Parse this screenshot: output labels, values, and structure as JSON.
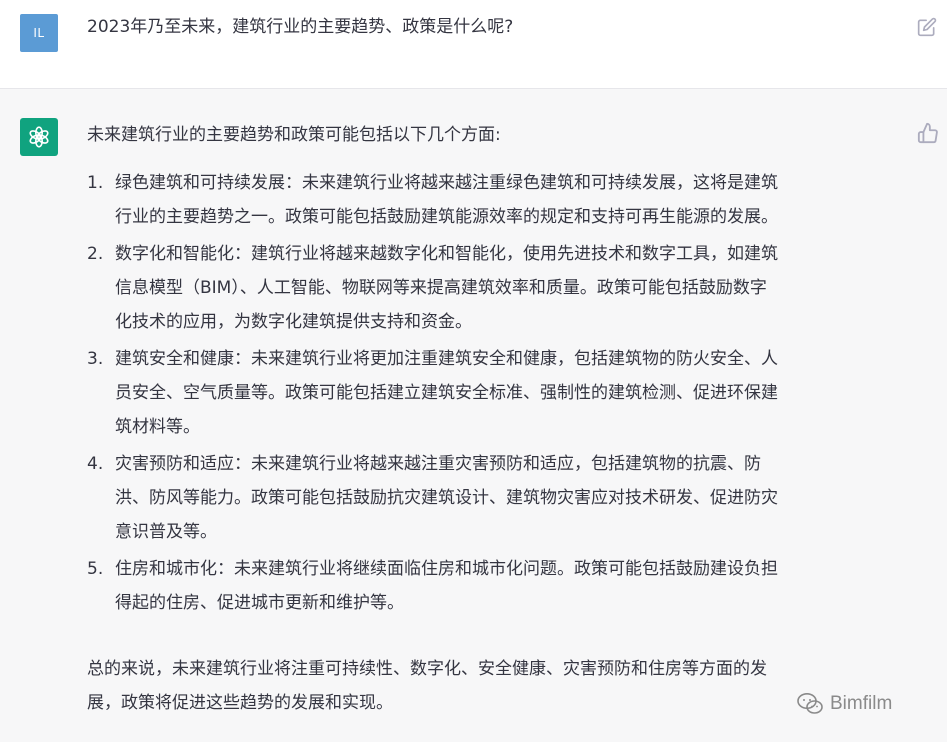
{
  "user": {
    "avatar_initials": "IL",
    "message": "2023年乃至未来，建筑行业的主要趋势、政策是什么呢?"
  },
  "assistant": {
    "intro": "未来建筑行业的主要趋势和政策可能包括以下几个方面:",
    "items": [
      {
        "num": "1.",
        "lines": [
          "绿色建筑和可持续发展：未来建筑行业将越来越注重绿色建筑和可持续发展，这将是建筑",
          "行业的主要趋势之一。政策可能包括鼓励建筑能源效率的规定和支持可再生能源的发展。"
        ]
      },
      {
        "num": "2.",
        "lines": [
          "数字化和智能化：建筑行业将越来越数字化和智能化，使用先进技术和数字工具，如建筑",
          "信息模型（BIM）、人工智能、物联网等来提高建筑效率和质量。政策可能包括鼓励数字",
          "化技术的应用，为数字化建筑提供支持和资金。"
        ]
      },
      {
        "num": "3.",
        "lines": [
          "建筑安全和健康：未来建筑行业将更加注重建筑安全和健康，包括建筑物的防火安全、人",
          "员安全、空气质量等。政策可能包括建立建筑安全标准、强制性的建筑检测、促进环保建",
          "筑材料等。"
        ]
      },
      {
        "num": "4.",
        "lines": [
          "灾害预防和适应：未来建筑行业将越来越注重灾害预防和适应，包括建筑物的抗震、防",
          "洪、防风等能力。政策可能包括鼓励抗灾建筑设计、建筑物灾害应对技术研发、促进防灾",
          "意识普及等。"
        ]
      },
      {
        "num": "5.",
        "lines": [
          "住房和城市化：未来建筑行业将继续面临住房和城市化问题。政策可能包括鼓励建设负担",
          "得起的住房、促进城市更新和维护等。"
        ]
      }
    ],
    "conclusion_lines": [
      "总的来说，未来建筑行业将注重可持续性、数字化、安全健康、灾害预防和住房等方面的发",
      "展，政策将促进这些趋势的发展和实现。"
    ]
  },
  "watermark": {
    "text": "Bimfilm"
  },
  "icons": {
    "edit": "edit-icon",
    "thumbs_up": "thumbs-up-icon",
    "bot_logo": "openai-logo-icon",
    "wechat": "wechat-icon"
  },
  "colors": {
    "user_avatar": "#5b9bd5",
    "bot_avatar": "#10a37f",
    "text": "#343541",
    "bot_bg": "#f7f7f8",
    "icon": "#acacbe"
  }
}
